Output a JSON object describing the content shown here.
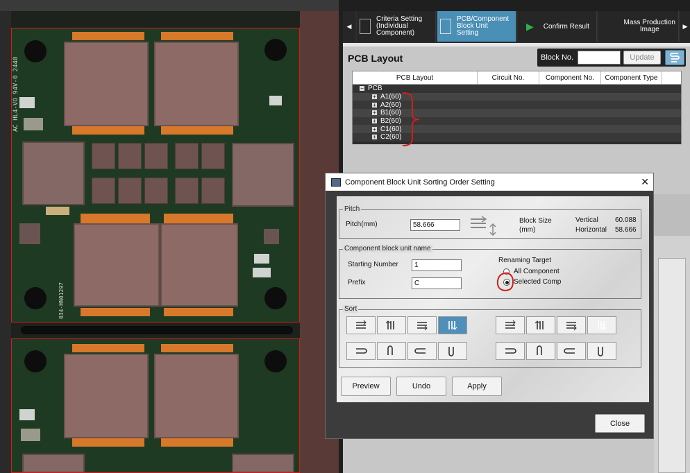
{
  "tabs": [
    {
      "label": "Criteria Setting\n(Individual\nComponent)"
    },
    {
      "label": "PCB/Component\nBlock Unit\nSetting"
    },
    {
      "label": "Confirm Result"
    },
    {
      "label": "Mass Production\nImage"
    }
  ],
  "panel": {
    "title": "PCB Layout",
    "block_no_label": "Block No.",
    "block_no_value": "",
    "update_label": "Update"
  },
  "grid": {
    "columns": [
      "PCB Layout",
      "Circuit No.",
      "Component No.",
      "Component Type"
    ],
    "root": "PCB",
    "rows": [
      "A1(60)",
      "A2(60)",
      "B1(60)",
      "B2(60)",
      "C1(60)",
      "C2(60)"
    ]
  },
  "dialog": {
    "title": "Component Block Unit Sorting Order Setting",
    "pitch": {
      "group_label": "Pitch",
      "pitch_label": "Pitch(mm)",
      "pitch_value": "58.666",
      "block_size_label": "Block Size\n(mm)",
      "vertical_label": "Vertical",
      "vertical_value": "60.088",
      "horizontal_label": "Horizontal",
      "horizontal_value": "58.666"
    },
    "name": {
      "group_label": "Component block unit name",
      "start_label": "Starting Number",
      "start_value": "1",
      "prefix_label": "Prefix",
      "prefix_value": "C",
      "target_label": "Renaming Target",
      "opt_all": "All Component",
      "opt_selected": "Selected Compo",
      "selected_option": "Selected Compo"
    },
    "sort": {
      "group_label": "Sort",
      "selected_index": 3
    },
    "buttons": {
      "preview": "Preview",
      "undo": "Undo",
      "apply": "Apply",
      "close": "Close"
    }
  },
  "pcb_labels": {
    "text1": "AC HL4-VO",
    "text2": "94V-0",
    "text3": "2440",
    "text4": "034-HN01297"
  },
  "colors": {
    "accent": "#4a8fb6",
    "annotation_red": "#d01e1e",
    "pcb_green": "#1f3a22",
    "pad_orange": "#d7782a"
  }
}
